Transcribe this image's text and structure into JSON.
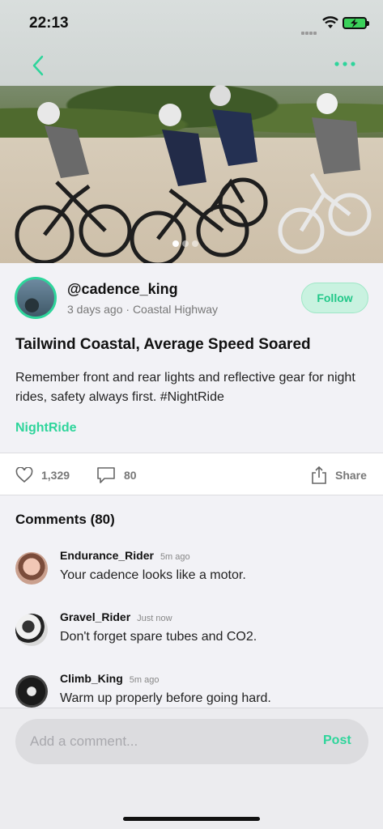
{
  "status_bar": {
    "time": "22:13"
  },
  "nav": {
    "back_icon": "chevron-left-icon",
    "more_icon": "more-dots-icon",
    "accent_color": "#2ed59b"
  },
  "hero": {
    "pages": 3,
    "active_page": 1
  },
  "post": {
    "username": "@cadence_king",
    "meta": "3 days ago · Coastal Highway",
    "follow_label": "Follow",
    "title": "Tailwind Coastal, Average Speed Soared",
    "body": "Remember front and rear lights and reflective gear for night rides, safety always first. #NightRide",
    "hashtag": "NightRide"
  },
  "actions": {
    "likes": "1,329",
    "comments": "80",
    "share_label": "Share"
  },
  "comments": {
    "title": "Comments (80)",
    "items": [
      {
        "name": "Endurance_Rider",
        "time": "5m ago",
        "text": "Your cadence looks like a motor."
      },
      {
        "name": "Gravel_Rider",
        "time": "Just now",
        "text": "Don't forget spare tubes and CO2."
      },
      {
        "name": "Climb_King",
        "time": "5m ago",
        "text": "Warm up properly before going hard."
      }
    ]
  },
  "comment_bar": {
    "placeholder": "Add a comment...",
    "post_label": "Post"
  }
}
